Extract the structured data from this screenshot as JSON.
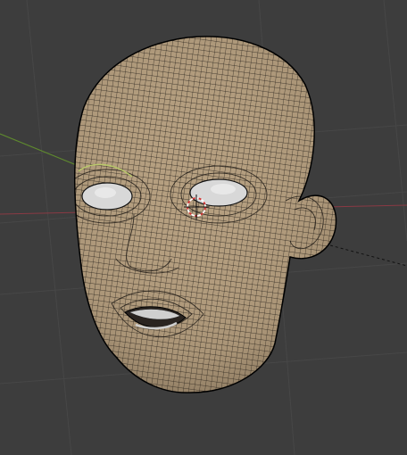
{
  "viewport": {
    "name": "3D Viewport",
    "background": "#3d3d3d",
    "grid_color": "#474747",
    "axis_x_color": "#8a3a44",
    "axis_y_color": "#5f8a2e",
    "mesh_fill": "#b59f80",
    "mesh_wire": "#1a1612",
    "mesh_outline": "#000000",
    "eye_color": "#d8d8d8",
    "teeth_color": "#cfcfcf",
    "cursor_color": "#d33636",
    "selection_color": "#b9c96b",
    "object": "head-mesh",
    "display_mode": "solid-with-wireframe"
  }
}
